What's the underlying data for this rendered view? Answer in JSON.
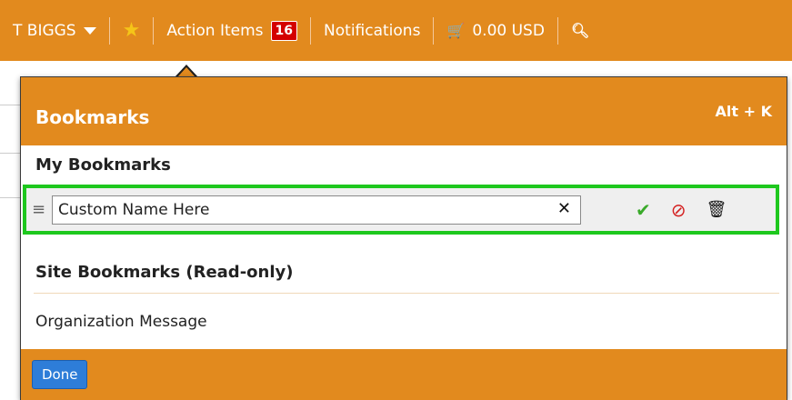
{
  "topbar": {
    "user_label": "T BIGGS",
    "action_items_label": "Action Items",
    "action_items_count": "16",
    "notifications_label": "Notifications",
    "cart_amount": "0.00 USD"
  },
  "popup": {
    "title": "Bookmarks",
    "shortcut": "Alt + K",
    "my_bookmarks_heading": "My Bookmarks",
    "bookmark_edit_value": "Custom Name Here",
    "site_bookmarks_heading": "Site Bookmarks (Read-only)",
    "site_bookmarks": [
      {
        "label": "Organization Message"
      }
    ],
    "done_label": "Done"
  },
  "colors": {
    "brand_orange": "#e28a1e",
    "highlight_green": "#1ec81e",
    "badge_red": "#d40000",
    "button_blue": "#2e7dd8"
  },
  "icons": [
    "caret-down-icon",
    "star-icon",
    "cart-icon",
    "search-icon",
    "drag-handle-icon",
    "clear-icon",
    "check-icon",
    "cancel-icon",
    "trash-icon"
  ]
}
